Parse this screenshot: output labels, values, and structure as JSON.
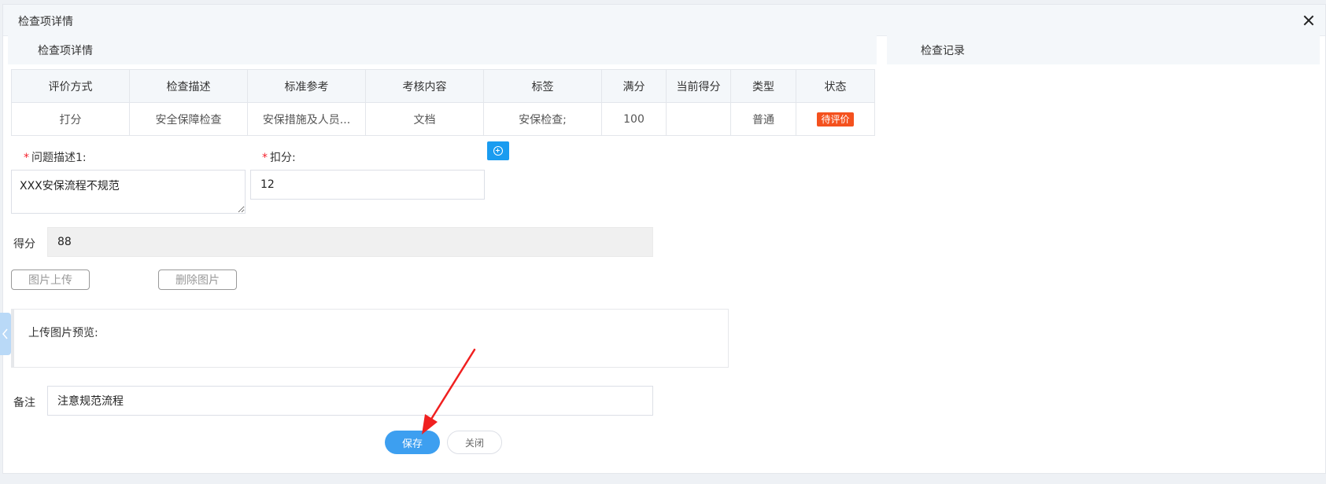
{
  "modal": {
    "title": "检查项详情",
    "left_section_title": "检查项详情",
    "right_section_title": "检查记录"
  },
  "table": {
    "headers": [
      "评价方式",
      "检查描述",
      "标准参考",
      "考核内容",
      "标签",
      "满分",
      "当前得分",
      "类型",
      "状态"
    ],
    "row": {
      "eval_method": "打分",
      "description": "安全保障检查",
      "standard": "安保措施及人员...",
      "content": "文档",
      "tag": "安保检查;",
      "full_score": "100",
      "current_score": "",
      "type": "普通",
      "status": "待评价"
    }
  },
  "form": {
    "problem_label": "问题描述1:",
    "problem_value": "XXX安保流程不规范",
    "deduct_label": "扣分:",
    "deduct_value": "12",
    "score_label": "得分",
    "score_value": "88",
    "upload_button": "图片上传",
    "delete_button": "删除图片",
    "preview_label": "上传图片预览:",
    "remark_label": "备注",
    "remark_value": "注意规范流程",
    "required_mark": "*"
  },
  "footer": {
    "save_label": "保存",
    "close_label": "关闭"
  },
  "icons": {
    "close": "close-icon",
    "add": "add-circle-icon",
    "collapse": "chevron-left-icon"
  },
  "colors": {
    "primary": "#3d9ff0",
    "add_button": "#1a9cf0",
    "status_badge": "#f4511e",
    "required": "#f5222d",
    "annotation_arrow": "#f02020"
  }
}
